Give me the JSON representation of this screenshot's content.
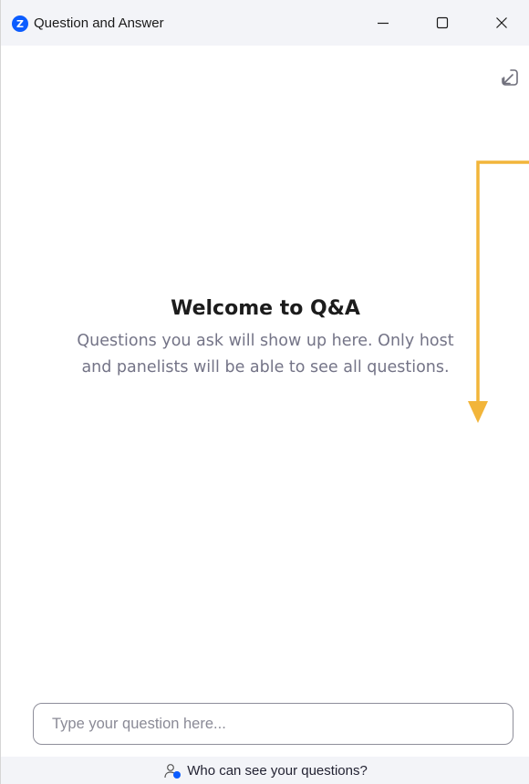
{
  "window": {
    "title": "Question and Answer",
    "app_icon_letter": "Z"
  },
  "welcome": {
    "title": "Welcome to Q&A",
    "subtitle": "Questions you ask will show up here. Only host and panelists will be able to see all questions."
  },
  "input": {
    "placeholder": "Type your question here..."
  },
  "footer": {
    "visibility_link": "Who can see your questions?"
  },
  "colors": {
    "accent": "#0b5cff",
    "annotation": "#f2b53a"
  }
}
